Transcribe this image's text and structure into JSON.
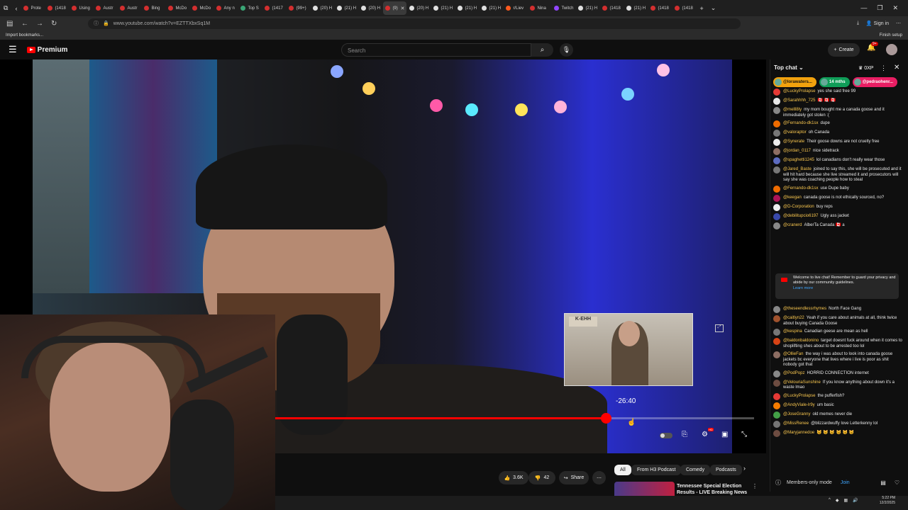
{
  "browser": {
    "tabs": [
      {
        "label": "Prote",
        "color": "#d32f2f"
      },
      {
        "label": "(1418",
        "color": "#d32f2f"
      },
      {
        "label": "Using",
        "color": "#d32f2f"
      },
      {
        "label": "Austr",
        "color": "#d32f2f"
      },
      {
        "label": "Austr",
        "color": "#d32f2f"
      },
      {
        "label": "Bing",
        "color": "#d32f2f"
      },
      {
        "label": "McDo",
        "color": "#d32f2f"
      },
      {
        "label": "McDo",
        "color": "#d32f2f"
      },
      {
        "label": "Any n",
        "color": "#d32f2f"
      },
      {
        "label": "Top S",
        "color": "#3aa675"
      },
      {
        "label": "(1417",
        "color": "#d32f2f"
      },
      {
        "label": "(99+)",
        "color": "#d32f2f"
      },
      {
        "label": "(20) H",
        "color": "#e0e0e0"
      },
      {
        "label": "(21) H",
        "color": "#e0e0e0"
      },
      {
        "label": "(20) H",
        "color": "#e0e0e0"
      },
      {
        "label": "(9)",
        "color": "#d32f2f",
        "active": true
      },
      {
        "label": "(20) H",
        "color": "#e0e0e0"
      },
      {
        "label": "(21) H",
        "color": "#e0e0e0"
      },
      {
        "label": "(21) H",
        "color": "#e0e0e0"
      },
      {
        "label": "(21) H",
        "color": "#e0e0e0"
      },
      {
        "label": "r/Liev",
        "color": "#ff5a1f"
      },
      {
        "label": "Nina",
        "color": "#d32f2f"
      },
      {
        "label": "Twitch",
        "color": "#9146ff"
      },
      {
        "label": "(21) H",
        "color": "#e0e0e0"
      },
      {
        "label": "(1418",
        "color": "#d32f2f"
      },
      {
        "label": "(21) H",
        "color": "#e0e0e0"
      },
      {
        "label": "(1418",
        "color": "#d32f2f"
      },
      {
        "label": "(1418",
        "color": "#d32f2f"
      }
    ],
    "url": "www.youtube.com/watch?v=EZTTXbxSq1M",
    "signin": "Sign in",
    "bookmarks_import": "Import bookmarks...",
    "finish_setup": "Finish setup"
  },
  "masthead": {
    "logo": "Premium",
    "search_placeholder": "Search",
    "create": "Create",
    "notif_count": "9+"
  },
  "player": {
    "mini_logo": "K-EHH",
    "tooltip_time": "-26:40",
    "progress_fraction": 0.69
  },
  "actions": {
    "likes": "3.6K",
    "dislikes": "42",
    "share": "Share"
  },
  "chips": [
    "All",
    "From H3 Podcast",
    "Comedy",
    "Podcasts"
  ],
  "recommendation": {
    "title": "Tennessee Special Election Results - LIVE Breaking News"
  },
  "chat": {
    "mode": "Top chat",
    "xp": "0XP",
    "pinned": [
      {
        "label": "@lorawaters...",
        "bg": "#f2a20e",
        "fg": "#111"
      },
      {
        "label": "14 mths",
        "bg": "#0f9d58",
        "fg": "#fff"
      },
      {
        "label": "@pedraohenr...",
        "bg": "#e91e63",
        "fg": "#fff"
      }
    ],
    "messages": [
      {
        "author": "@LuckyProlapse",
        "text": "yes she said free 99",
        "color": "#e53935"
      },
      {
        "author": "@Sarahhhh_725",
        "text": "🇨🇦 🇨🇦 🇨🇦",
        "color": "#e8e8e8"
      },
      {
        "author": "@melll8ly",
        "text": "my mom bought me a canada goose and it immediately got stolen :(",
        "color": "#888"
      },
      {
        "author": "@Fernando-dk1sx",
        "text": "dupe",
        "color": "#ef6c00"
      },
      {
        "author": "@valoraptor",
        "text": "oh Canada",
        "color": "#777"
      },
      {
        "author": "@Synerate",
        "text": "Their goose downs are not cruelty free",
        "color": "#eee"
      },
      {
        "author": "@jordan_0117",
        "text": "nice sidetrack",
        "color": "#8d6e63"
      },
      {
        "author": "@spaghetti1245",
        "text": "lol canadians don't really wear those",
        "color": "#5c6bc0"
      },
      {
        "author": "@Jared_Baste",
        "text": "joined to say this, she will be prosecuted and it will hit hard because she live streamed it and prosecutors will say she was coaching people how to steal",
        "color": "#777"
      },
      {
        "author": "@Fernando-dk1sx",
        "text": "use Dupe baby",
        "color": "#ef6c00"
      },
      {
        "author": "@keegan",
        "text": "canada goose is not ethically sourced, no?",
        "color": "#ad1457"
      },
      {
        "author": "@D-Corporation",
        "text": "buy reps",
        "color": "#eee"
      },
      {
        "author": "@debilitupcio6197",
        "text": "Ugly ass jacket",
        "color": "#3949ab"
      },
      {
        "author": "@cranerd",
        "text": "AlberTa Canada 🇨🇦 a",
        "color": "#888"
      }
    ],
    "notice": {
      "text": "Welcome to live chat! Remember to guard your privacy and abide by our community guidelines.",
      "link": "Learn more"
    },
    "messages2": [
      {
        "author": "@theseendlessrhymes",
        "text": "North Face Gang",
        "color": "#888"
      },
      {
        "author": "@caitlyn22",
        "text": "Yeah if you care about animals at all, think twice about buying Canada Goose",
        "color": "#a0522d"
      },
      {
        "author": "@kespina",
        "text": "Canadian geese are mean as hell",
        "color": "#777"
      },
      {
        "author": "@baldonbaldonino",
        "text": "target doesnt fuck around when it comes to shoplifting shes about to be arrested too lol",
        "color": "#d84315"
      },
      {
        "author": "@OllieFan",
        "text": "the way i was about to look into canada goose jackets bc everyone that lives where i live is poor as shit nobody got that",
        "color": "#8d6e63"
      },
      {
        "author": "@PodPopz",
        "text": "HORRID CONNECTION internet",
        "color": "#888"
      },
      {
        "author": "@VelouriaSunshine",
        "text": "If you know anything about down it's a waste lmao",
        "color": "#6d4c41"
      },
      {
        "author": "@LuckyProlapse",
        "text": "the pufferfish?",
        "color": "#e53935"
      },
      {
        "author": "@AndyViale-lr9y",
        "text": "um basic",
        "color": "#f57c00"
      },
      {
        "author": "@JoseGranny",
        "text": "old memes never die",
        "color": "#43a047"
      },
      {
        "author": "@MissRenee",
        "text": "@blizzardwuffy love Letterkenny lol",
        "color": "#757575"
      },
      {
        "author": "@Maryjannedoe",
        "text": "😼 😼 😼 😼 😼 😼",
        "color": "#6d4c41"
      }
    ],
    "footer": {
      "mode": "Members-only mode",
      "join": "Join"
    }
  },
  "taskbar": {
    "time": "5:22 PM",
    "date": "12/2/2025"
  }
}
